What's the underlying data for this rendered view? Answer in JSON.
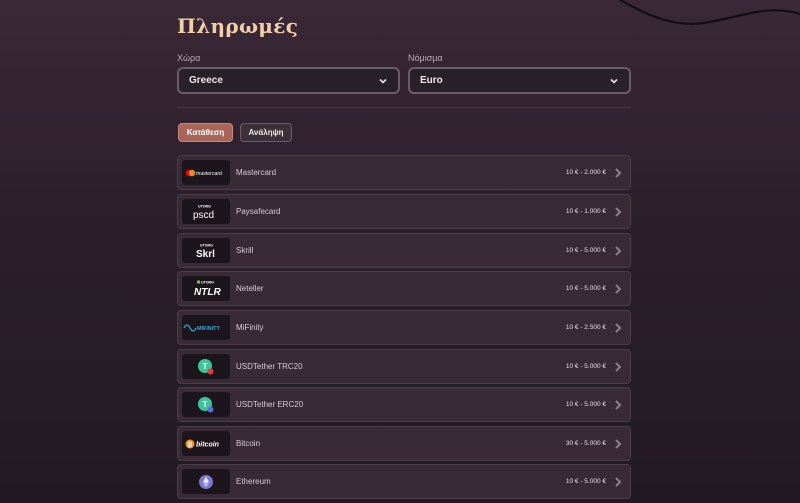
{
  "page": {
    "title": "Πληρωμές"
  },
  "country": {
    "label": "Χώρα",
    "value": "Greece"
  },
  "currency": {
    "label": "Νόμισμα",
    "value": "Euro"
  },
  "tabs": {
    "deposit": "Κατάθεση",
    "withdraw": "Ανάληψη"
  },
  "colors": {
    "accent": "#a8665a",
    "title": "#f3cfa9",
    "row_bg": "#382b35"
  },
  "methods": [
    {
      "name": "Mastercard",
      "range": "10 € - 2.000 €",
      "logo_text": "mastercard",
      "icon": "mastercard-logo"
    },
    {
      "name": "Paysafecard",
      "range": "10 € - 1.000 €",
      "logo_text": "pscd",
      "logo_sub": "UTORG",
      "icon": "paysafecard-logo"
    },
    {
      "name": "Skrill",
      "range": "10 € - 5.000 €",
      "logo_text": "Skrl",
      "logo_sub": "UTORG",
      "icon": "skrill-logo"
    },
    {
      "name": "Neteller",
      "range": "10 € - 5.000 €",
      "logo_text": "NTLR",
      "logo_sub": "UTORG",
      "icon": "neteller-logo"
    },
    {
      "name": "MiFinity",
      "range": "10 € - 2.500 €",
      "logo_text": "MIFINITY",
      "icon": "mifinity-logo"
    },
    {
      "name": "USDTether TRC20",
      "range": "10 € - 5.000 €",
      "icon": "tether-trc20-logo"
    },
    {
      "name": "USDTether ERC20",
      "range": "10 € - 5.000 €",
      "icon": "tether-erc20-logo"
    },
    {
      "name": "Bitcoin",
      "range": "30 € - 5.000 €",
      "logo_text": "bitcoin",
      "icon": "bitcoin-logo"
    },
    {
      "name": "Ethereum",
      "range": "10 € - 5.000 €",
      "icon": "ethereum-logo"
    }
  ]
}
